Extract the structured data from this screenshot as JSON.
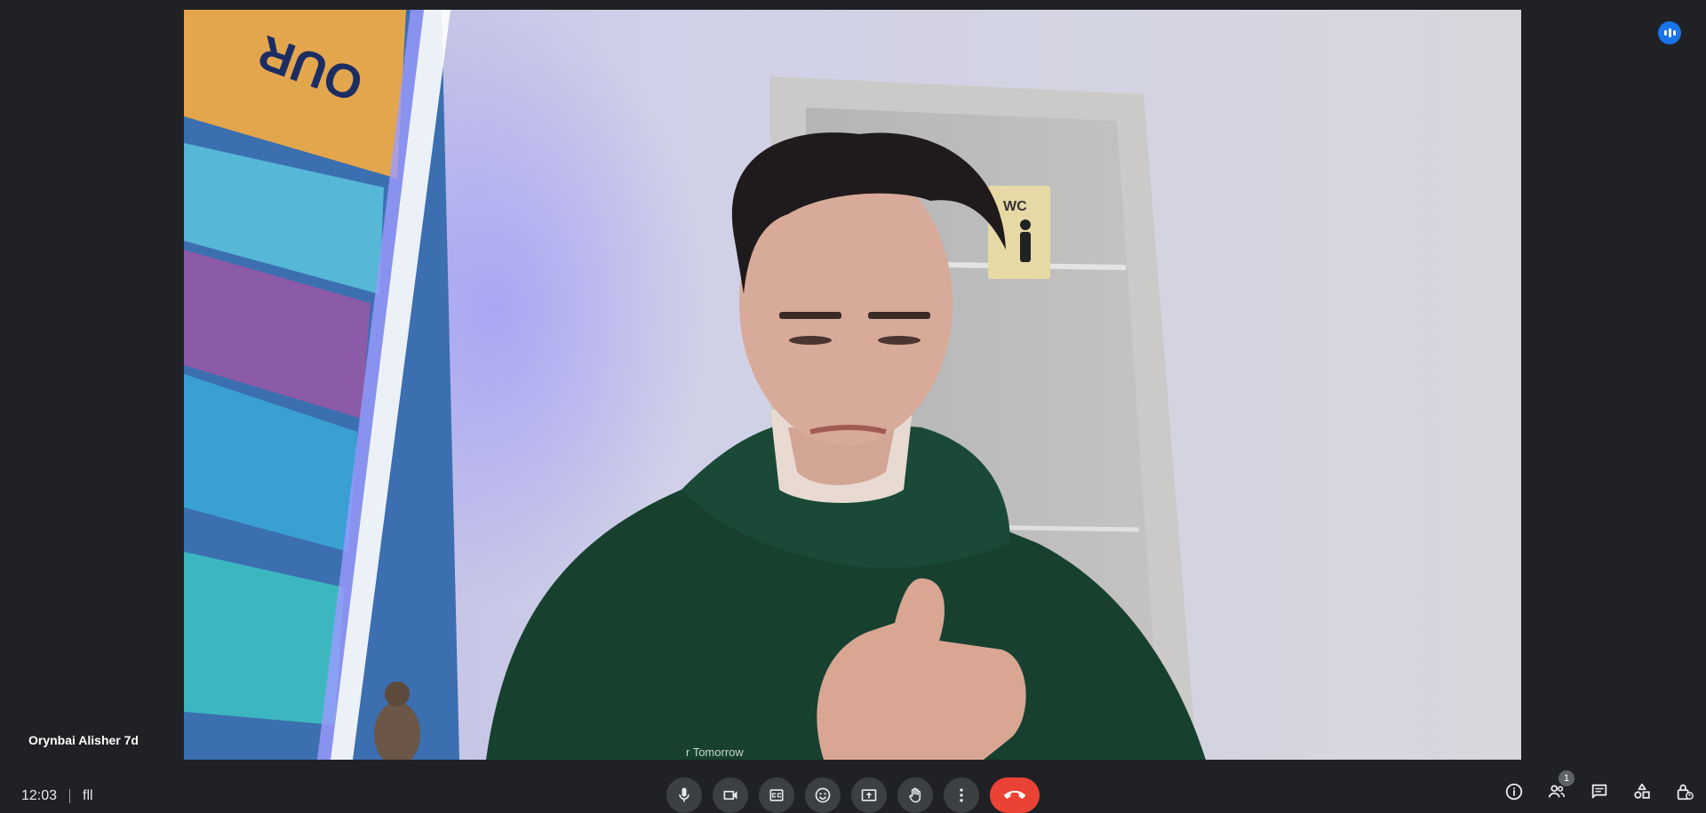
{
  "participant": {
    "name": "Orynbai Alisher 7d"
  },
  "meeting": {
    "time": "12:03",
    "code": "fll"
  },
  "video": {
    "sign_text": "WC",
    "poster_title": "OUR",
    "hoodie_text": "r Tomorrow"
  },
  "controls": [
    {
      "name": "mic-button",
      "icon": "microphone-icon"
    },
    {
      "name": "camera-button",
      "icon": "videocam-icon"
    },
    {
      "name": "captions-button",
      "icon": "closed-captions-icon"
    },
    {
      "name": "reactions-button",
      "icon": "emoji-icon"
    },
    {
      "name": "present-button",
      "icon": "present-screen-icon"
    },
    {
      "name": "raise-hand-button",
      "icon": "hand-icon"
    },
    {
      "name": "more-options-button",
      "icon": "more-vert-icon"
    },
    {
      "name": "leave-call-button",
      "icon": "call-end-icon"
    }
  ],
  "side": {
    "people_count": "1"
  },
  "colors": {
    "accent": "#1a73e8",
    "end_call": "#ea4335",
    "bar_bg": "#202124",
    "button_bg": "#3c4043"
  }
}
